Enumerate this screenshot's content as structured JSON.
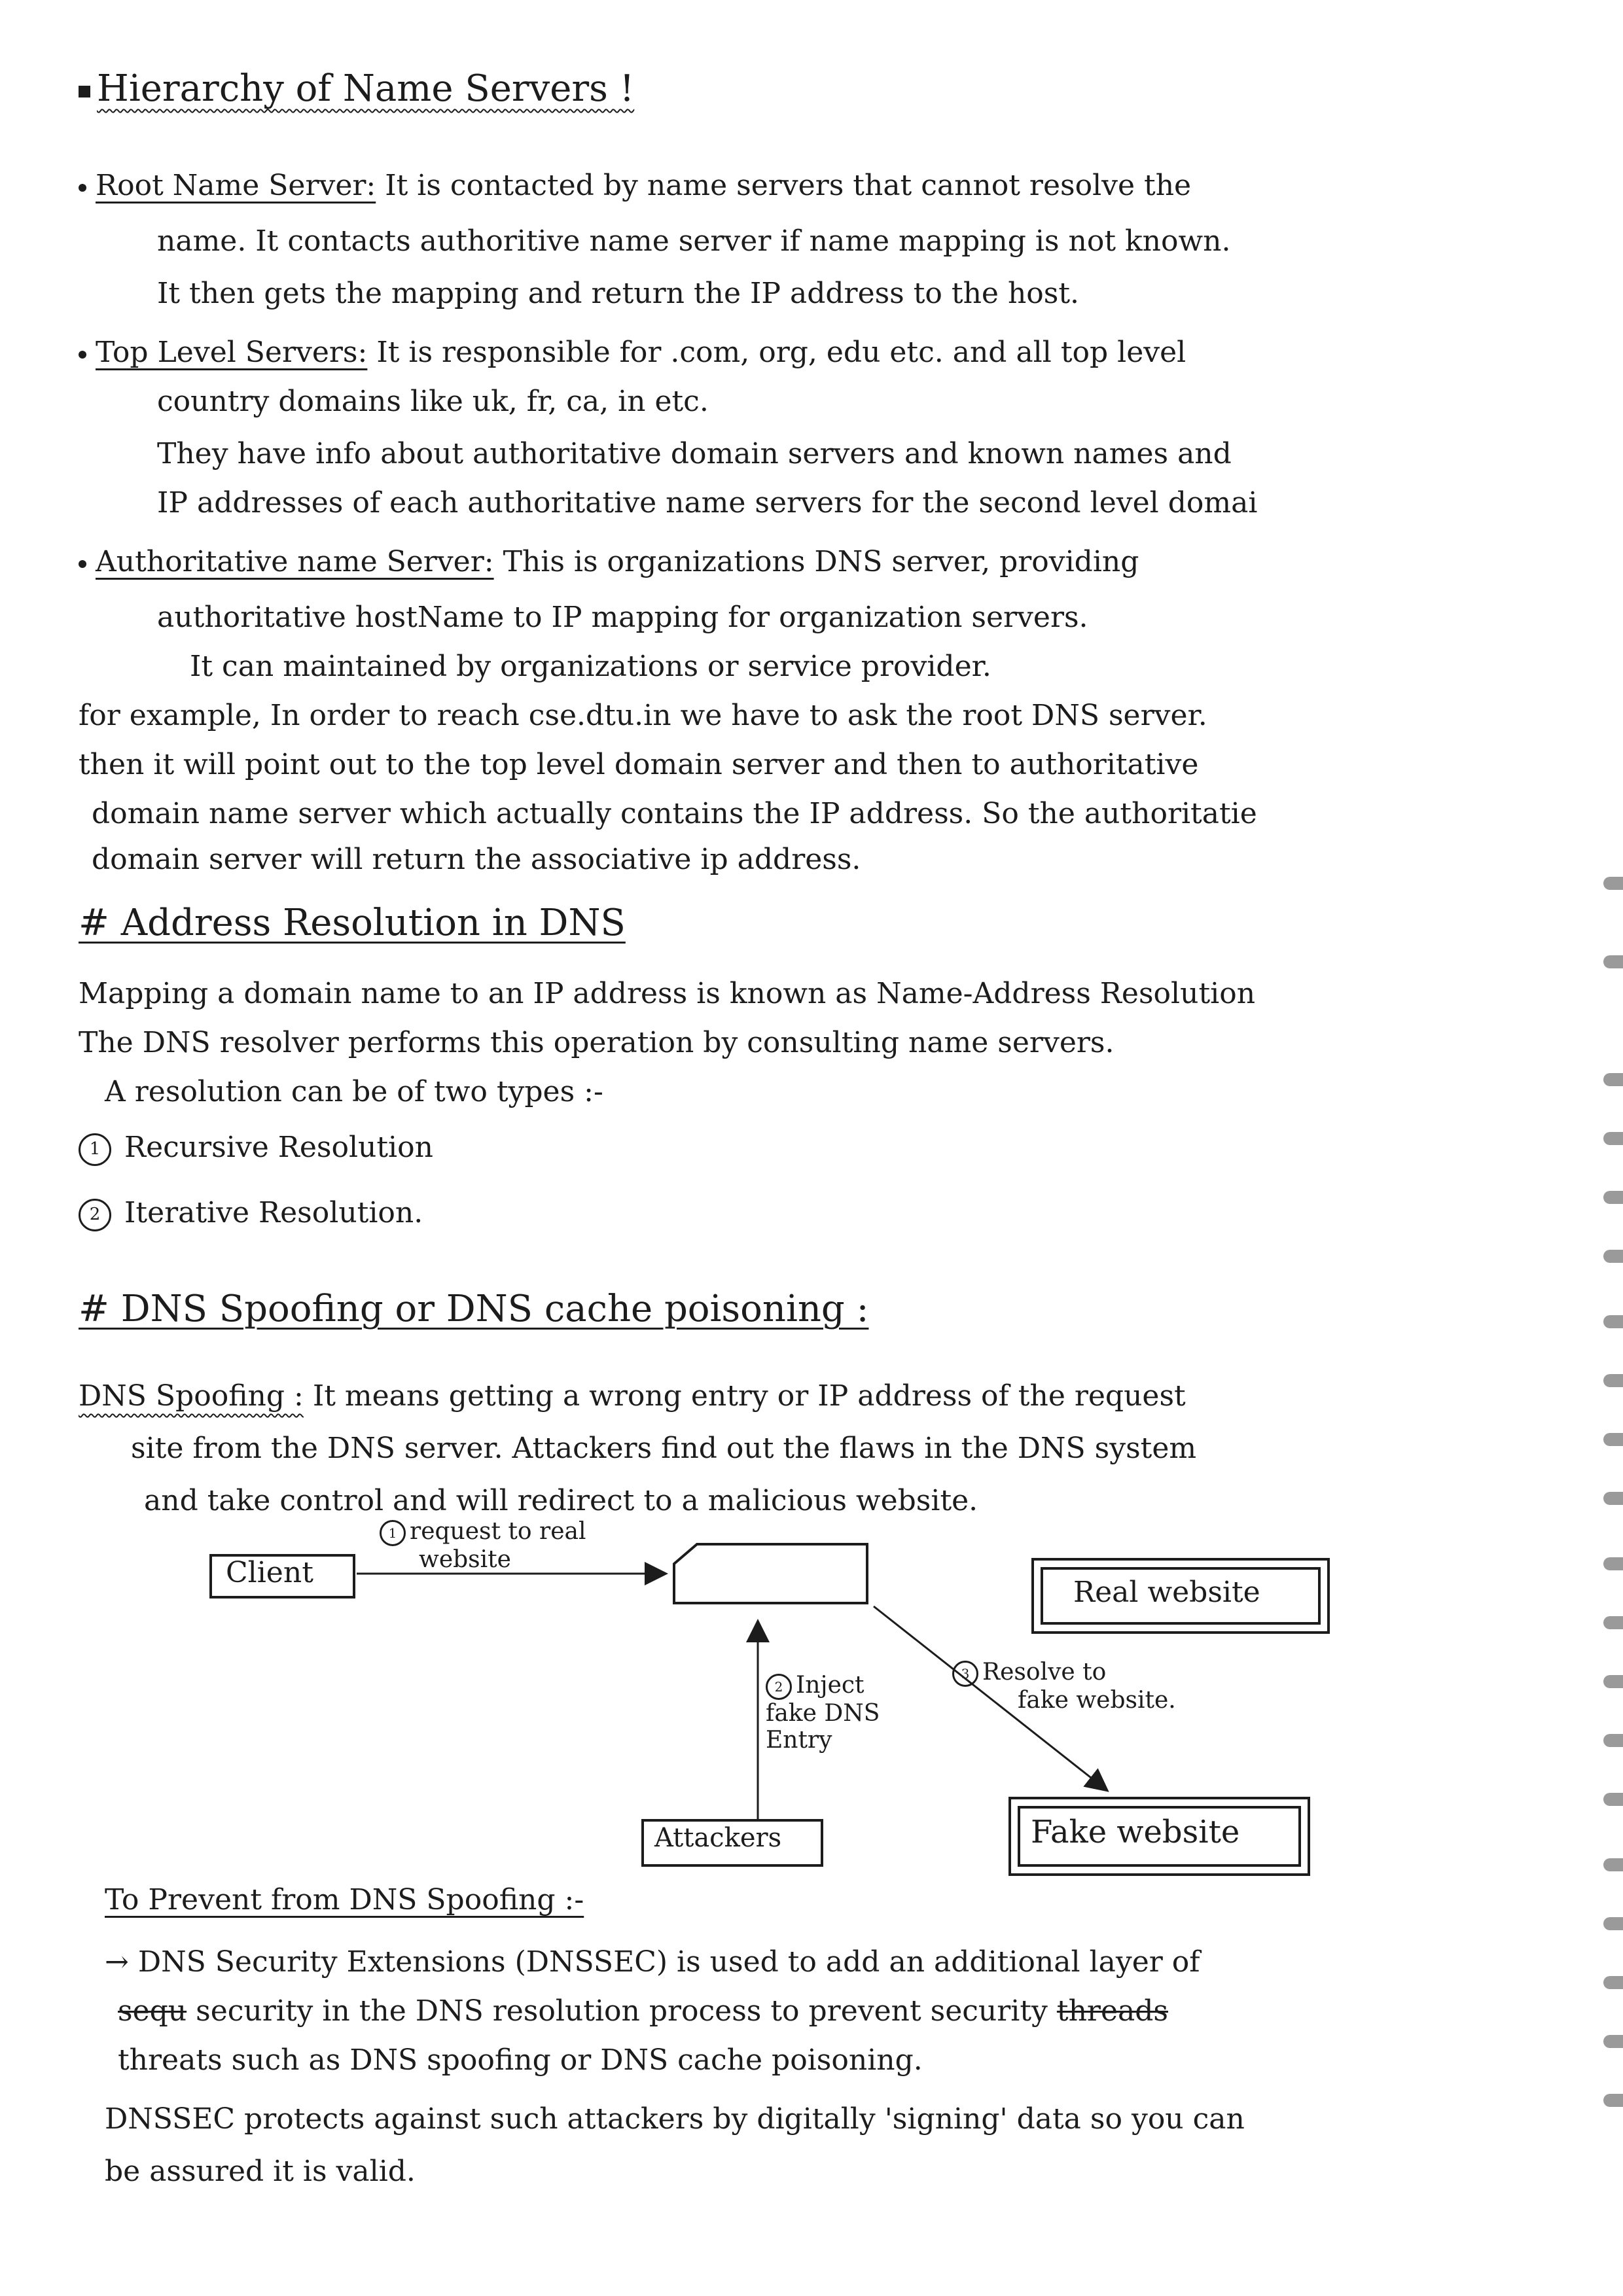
{
  "section1": {
    "heading": "Hierarchy of Name Servers !",
    "root": {
      "term": "Root Name Server:",
      "lines": [
        "It is contacted by name servers that cannot resolve the",
        "name. It contacts authoritive name server if name mapping is not known.",
        "It then gets the mapping and return the IP address to the host."
      ]
    },
    "tld": {
      "term": "Top Level Servers:",
      "lines": [
        "It is responsible for .com, org, edu etc. and all top level",
        "country domains like uk, fr, ca, in etc.",
        "They have info about authoritative domain servers and known names and",
        "IP addresses of each authoritative name servers for the second level domai"
      ]
    },
    "auth": {
      "term": "Authoritative name Server:",
      "lines": [
        "This is organizations DNS server, providing",
        "authoritative hostName to IP mapping for organization servers.",
        "It can maintained by organizations or service provider."
      ]
    },
    "example_lines": [
      "for example, In order to reach cse.dtu.in we have to ask the root DNS server.",
      "then it will point out to the top level domain server and then to authoritative",
      "domain name server which actually contains the IP address. So the authoritatie",
      "domain server will return the associative ip address."
    ]
  },
  "section2": {
    "heading": "# Address Resolution in DNS",
    "lines": [
      "Mapping a domain name to an IP address is known as Name-Address Resolution",
      "The DNS resolver performs this operation by consulting name servers.",
      "A resolution can be of two types :-"
    ],
    "types": [
      {
        "num": "1",
        "label": "Recursive Resolution"
      },
      {
        "num": "2",
        "label": "Iterative Resolution."
      }
    ]
  },
  "section3": {
    "heading": "# DNS Spoofing or DNS cache poisoning :",
    "term": "DNS Spoofing :",
    "lines": [
      "It means getting a wrong entry or IP address of the request",
      "site from the DNS server. Attackers find out the flaws in the DNS system",
      "and take control and will redirect to a malicious website."
    ]
  },
  "diagram": {
    "client": "Client",
    "real_site": "Real website",
    "attackers": "Attackers",
    "fake_site": "Fake website",
    "step1_num": "1",
    "step1": [
      "request to real",
      "website"
    ],
    "step2_num": "2",
    "step2": [
      "Inject",
      "fake DNS",
      "Entry"
    ],
    "step3_num": "3",
    "step3": [
      "Resolve to",
      "fake website."
    ]
  },
  "section4": {
    "heading": "To Prevent from DNS Spoofing :-",
    "line1": "DNS Security Extensions (DNSSEC) is used to add an additional layer of",
    "line2_struck": "sequ",
    "line2": "security in the DNS resolution process to prevent security",
    "line2_struck_end": "threads",
    "line3": "threats such as DNS spoofing or DNS cache poisoning.",
    "line4": "DNSSEC protects against such attackers by digitally 'signing' data so you can",
    "line5": "be assured it is valid."
  }
}
